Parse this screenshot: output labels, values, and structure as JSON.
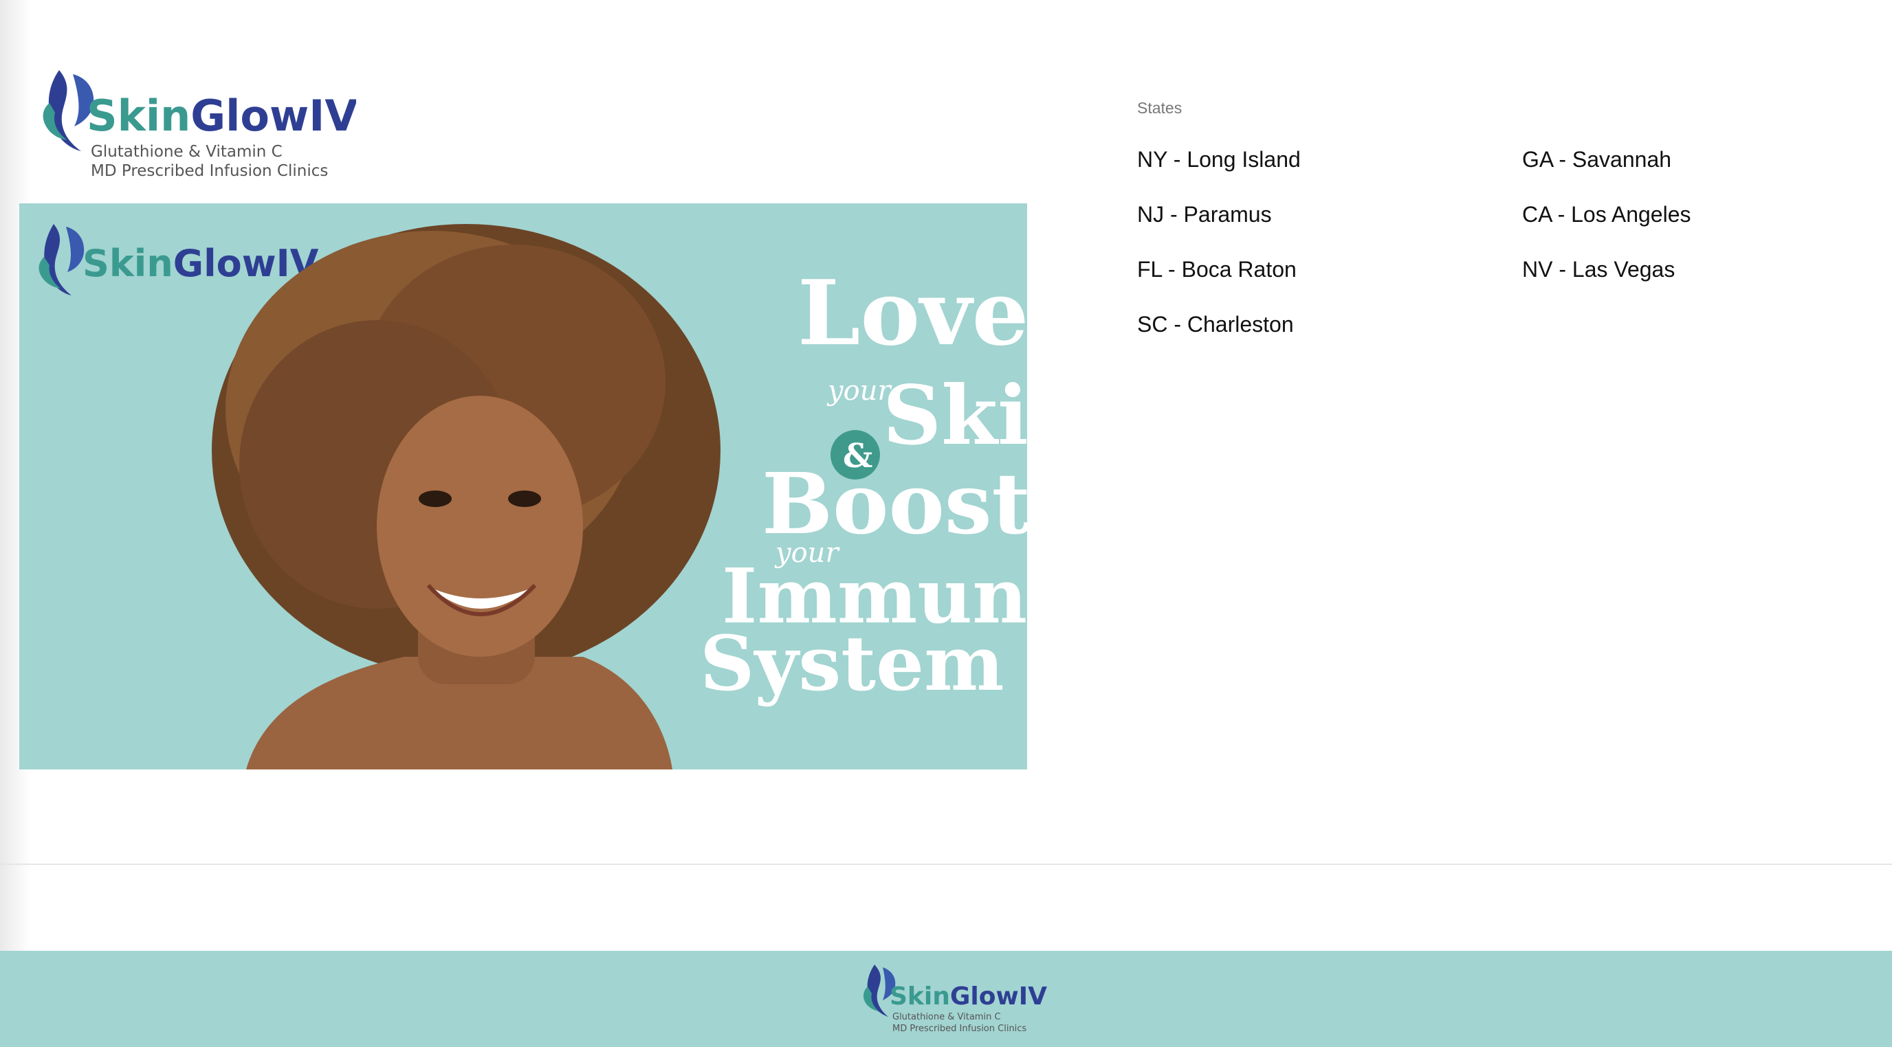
{
  "header": {
    "logo": {
      "name_part1": "Skin",
      "name_part2": "GlowIV",
      "tagline_line1": "Glutathione & Vitamin C",
      "tagline_line2": "MD Prescribed Infusion Clinics"
    }
  },
  "hero": {
    "logo": {
      "name_part1": "Skin",
      "name_part2": "GlowIV"
    },
    "headline": {
      "love": "Love",
      "your1": "your",
      "skin": "Skin",
      "amp": "&",
      "boost": "Boost",
      "your2": "your",
      "immune": "Immune",
      "system": "System"
    }
  },
  "states": {
    "label": "States",
    "items": [
      "NY - Long Island",
      "GA - Savannah",
      "NJ - Paramus",
      "CA - Los Angeles",
      "FL - Boca Raton",
      "NV - Las Vegas",
      "SC - Charleston"
    ]
  },
  "footer": {
    "logo": {
      "name_part1": "Skin",
      "name_part2": "GlowIV",
      "tagline_line1": "Glutathione & Vitamin C",
      "tagline_line2": "MD Prescribed Infusion Clinics"
    }
  },
  "colors": {
    "brand_teal": "#3a9a90",
    "brand_navy": "#2e3f93",
    "banner_bg": "#a2d4d1"
  }
}
